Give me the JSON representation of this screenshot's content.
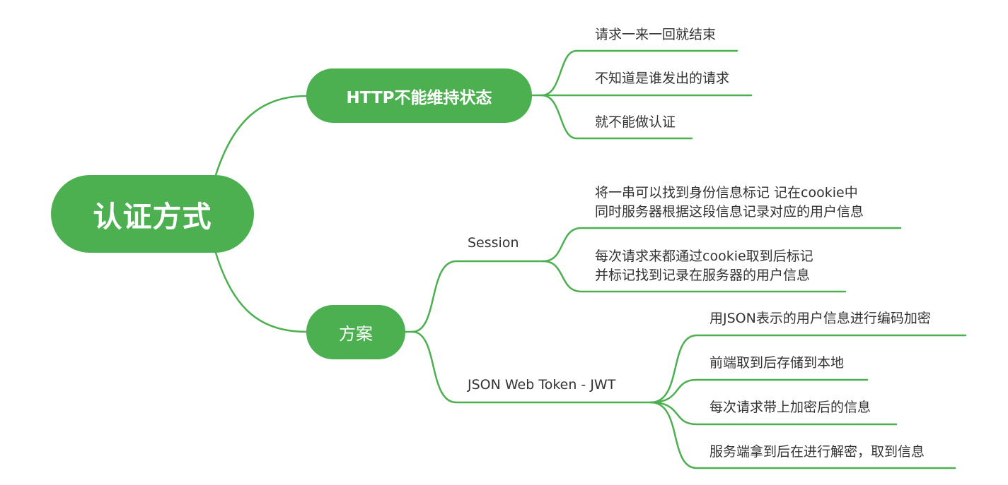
{
  "theme": {
    "accent": "#4caf50",
    "text": "#333333"
  },
  "mindmap": {
    "root": "认证方式",
    "branches": [
      {
        "label": "HTTP不能维持状态",
        "children": [
          "请求一来一回就结束",
          "不知道是谁发出的请求",
          "就不能做认证"
        ]
      },
      {
        "label": "方案",
        "children": [
          {
            "label": "Session",
            "children": [
              [
                "将一串可以找到身份信息标记 记在cookie中",
                "同时服务器根据这段信息记录对应的用户信息"
              ],
              [
                "每次请求来都通过cookie取到后标记",
                "并标记找到记录在服务器的用户信息"
              ]
            ]
          },
          {
            "label": "JSON Web Token - JWT",
            "children": [
              "用JSON表示的用户信息进行编码加密",
              "前端取到后存储到本地",
              "每次请求带上加密后的信息",
              "服务端拿到后在进行解密，取到信息"
            ]
          }
        ]
      }
    ]
  }
}
